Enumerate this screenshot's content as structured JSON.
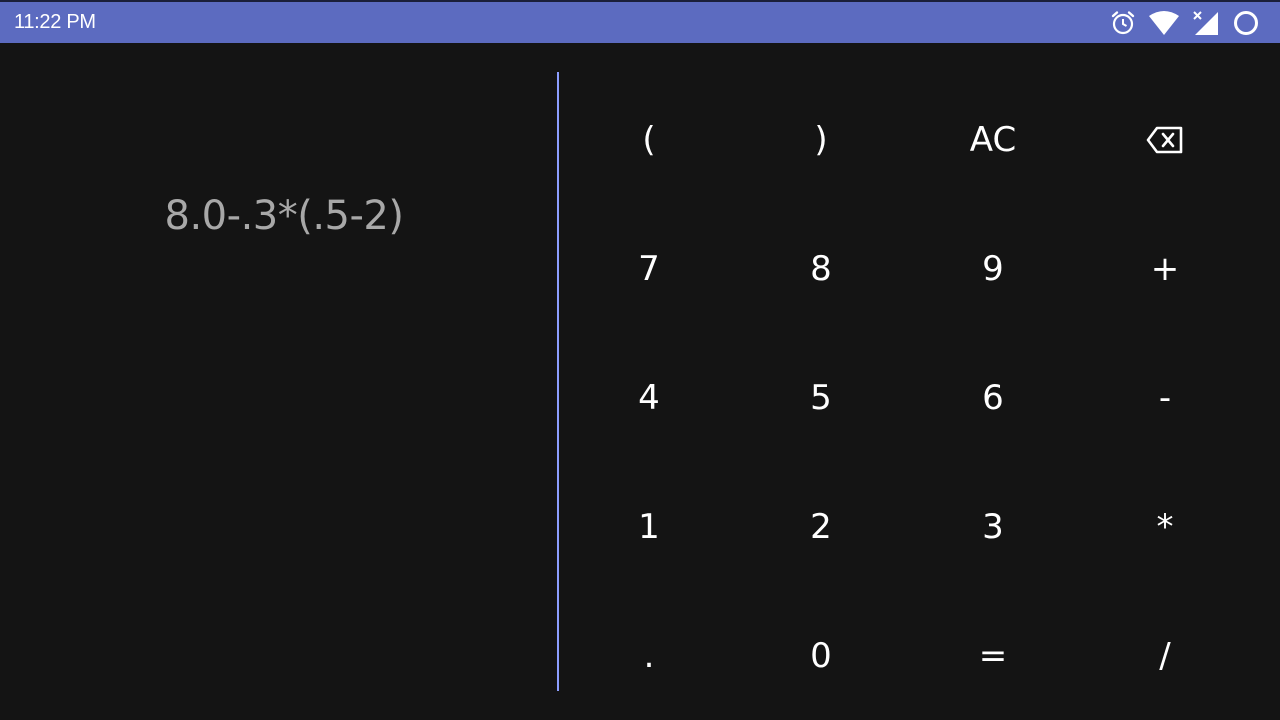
{
  "status_bar": {
    "time": "11:22 PM",
    "icons": [
      "alarm-icon",
      "wifi-icon",
      "cellular-no-signal-icon",
      "battery-ring-icon"
    ],
    "background": "#5c6bc0"
  },
  "display": {
    "expression": "8.0-.3*(.5-2)",
    "text_color": "#a8a8a8"
  },
  "divider_color": "#8c9eff",
  "keypad": {
    "keys": [
      {
        "label": "(",
        "name": "open-paren-key"
      },
      {
        "label": ")",
        "name": "close-paren-key"
      },
      {
        "label": "AC",
        "name": "all-clear-key"
      },
      {
        "label": "",
        "name": "backspace-key",
        "icon": "backspace-icon"
      },
      {
        "label": "7",
        "name": "digit-7-key"
      },
      {
        "label": "8",
        "name": "digit-8-key"
      },
      {
        "label": "9",
        "name": "digit-9-key"
      },
      {
        "label": "+",
        "name": "plus-key"
      },
      {
        "label": "4",
        "name": "digit-4-key"
      },
      {
        "label": "5",
        "name": "digit-5-key"
      },
      {
        "label": "6",
        "name": "digit-6-key"
      },
      {
        "label": "-",
        "name": "minus-key"
      },
      {
        "label": "1",
        "name": "digit-1-key"
      },
      {
        "label": "2",
        "name": "digit-2-key"
      },
      {
        "label": "3",
        "name": "digit-3-key"
      },
      {
        "label": "*",
        "name": "multiply-key"
      },
      {
        "label": ".",
        "name": "decimal-key"
      },
      {
        "label": "0",
        "name": "digit-0-key"
      },
      {
        "label": "=",
        "name": "equals-key"
      },
      {
        "label": "/",
        "name": "divide-key"
      }
    ]
  }
}
